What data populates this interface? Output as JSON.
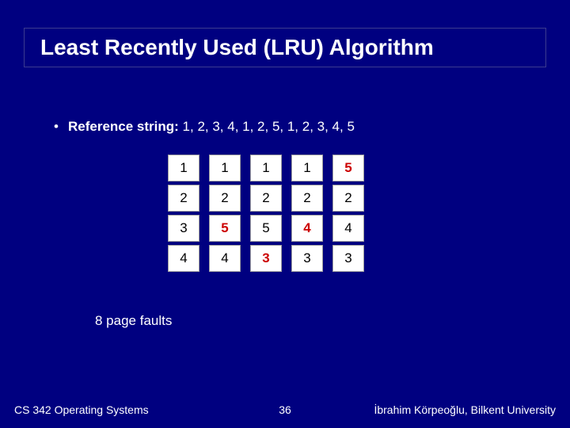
{
  "title": "Least Recently Used (LRU) Algorithm",
  "bullet": {
    "dot": "•",
    "label": "Reference string:  ",
    "values": "1, 2, 3, 4, 1, 2, 5, 1, 2, 3, 4, 5"
  },
  "chart_data": {
    "type": "table",
    "title": "LRU page frame states",
    "columns": [
      {
        "cells": [
          {
            "v": "1",
            "hl": false
          },
          {
            "v": "2",
            "hl": false
          },
          {
            "v": "3",
            "hl": false
          },
          {
            "v": "4",
            "hl": false
          }
        ]
      },
      {
        "cells": [
          {
            "v": "1",
            "hl": false
          },
          {
            "v": "2",
            "hl": false
          },
          {
            "v": "5",
            "hl": true
          },
          {
            "v": "4",
            "hl": false
          }
        ]
      },
      {
        "cells": [
          {
            "v": "1",
            "hl": false
          },
          {
            "v": "2",
            "hl": false
          },
          {
            "v": "5",
            "hl": false
          },
          {
            "v": "3",
            "hl": true
          }
        ]
      },
      {
        "cells": [
          {
            "v": "1",
            "hl": false
          },
          {
            "v": "2",
            "hl": false
          },
          {
            "v": "4",
            "hl": true
          },
          {
            "v": "3",
            "hl": false
          }
        ]
      },
      {
        "cells": [
          {
            "v": "5",
            "hl": true
          },
          {
            "v": "2",
            "hl": false
          },
          {
            "v": "4",
            "hl": false
          },
          {
            "v": "3",
            "hl": false
          }
        ]
      }
    ]
  },
  "faults": "8 page faults",
  "footer": {
    "left": "CS 342 Operating Systems",
    "center": "36",
    "right": "İbrahim Körpeoğlu, Bilkent University"
  }
}
